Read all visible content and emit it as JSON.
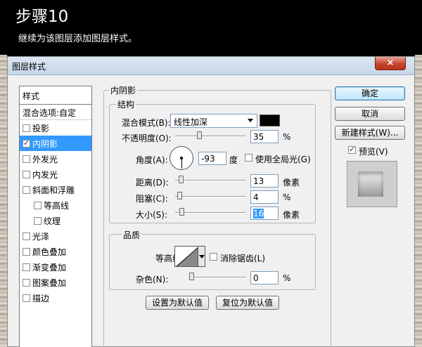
{
  "page": {
    "step_title": "步骤10",
    "step_desc": "继续为该图层添加图层样式。"
  },
  "dialog": {
    "title": "图层样式",
    "close_symbol": "×"
  },
  "style_list": {
    "header": "样式",
    "blend_options": "混合选项:自定",
    "items": [
      {
        "label": "投影",
        "checked": false,
        "selected": false,
        "sub": false
      },
      {
        "label": "内阴影",
        "checked": true,
        "selected": true,
        "sub": false
      },
      {
        "label": "外发光",
        "checked": false,
        "selected": false,
        "sub": false
      },
      {
        "label": "内发光",
        "checked": false,
        "selected": false,
        "sub": false
      },
      {
        "label": "斜面和浮雕",
        "checked": false,
        "selected": false,
        "sub": false
      },
      {
        "label": "等高线",
        "checked": false,
        "selected": false,
        "sub": true
      },
      {
        "label": "纹理",
        "checked": false,
        "selected": false,
        "sub": true
      },
      {
        "label": "光泽",
        "checked": false,
        "selected": false,
        "sub": false
      },
      {
        "label": "颜色叠加",
        "checked": false,
        "selected": false,
        "sub": false
      },
      {
        "label": "渐变叠加",
        "checked": false,
        "selected": false,
        "sub": false
      },
      {
        "label": "图案叠加",
        "checked": false,
        "selected": false,
        "sub": false
      },
      {
        "label": "描边",
        "checked": false,
        "selected": false,
        "sub": false
      }
    ]
  },
  "inner_shadow": {
    "group_title": "内阴影",
    "structure": {
      "title": "结构",
      "blend_mode_label": "混合模式(B):",
      "blend_mode_value": "线性加深",
      "shadow_color": "#000000",
      "opacity_label": "不透明度(O):",
      "opacity_value": "35",
      "opacity_unit": "%",
      "opacity_fraction": 0.35,
      "angle_label": "角度(A):",
      "angle_value": "-93",
      "angle_unit": "度",
      "global_light_label": "使用全局光(G)",
      "global_light_checked": false,
      "distance_label": "距离(D):",
      "distance_value": "13",
      "distance_unit": "像素",
      "choke_label": "阻塞(C):",
      "choke_value": "4",
      "choke_unit": "%",
      "size_label": "大小(S):",
      "size_value": "16",
      "size_unit": "像素"
    },
    "quality": {
      "title": "品质",
      "contour_label": "等高线:",
      "anti_alias_label": "消除锯齿(L)",
      "anti_alias_checked": false,
      "noise_label": "杂色(N):",
      "noise_value": "0",
      "noise_unit": "%"
    },
    "set_default": "设置为默认值",
    "reset_default": "复位为默认值"
  },
  "right_panel": {
    "ok": "确定",
    "cancel": "取消",
    "new_style": "新建样式(W)...",
    "preview_label": "预览(V)",
    "preview_checked": true
  }
}
